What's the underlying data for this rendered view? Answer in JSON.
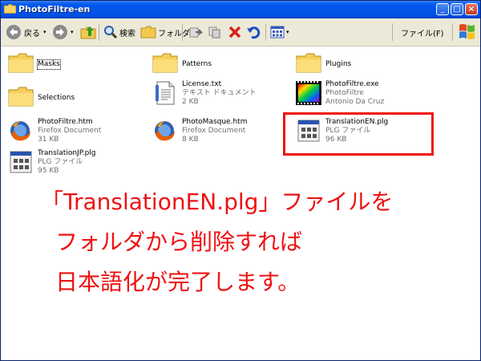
{
  "window": {
    "title": "PhotoFiltre-en"
  },
  "toolbar": {
    "back_label": "戻る",
    "search_label": "検索",
    "folders_label": "フォルダ",
    "file_menu_label": "ファイル(F)"
  },
  "items": [
    {
      "name": "Masks",
      "type": "folder"
    },
    {
      "name": "Patterns",
      "type": "folder"
    },
    {
      "name": "Plugins",
      "type": "folder"
    },
    {
      "name": "Selections",
      "type": "folder"
    },
    {
      "name": "License.txt",
      "line1": "テキスト ドキュメント",
      "line2": "2 KB",
      "type": "text"
    },
    {
      "name": "PhotoFiltre.exe",
      "line1": "PhotoFiltre",
      "line2": "Antonio Da Cruz",
      "type": "exe"
    },
    {
      "name": "PhotoFiltre.htm",
      "line1": "Firefox Document",
      "line2": "31 KB",
      "type": "html"
    },
    {
      "name": "PhotoMasque.htm",
      "line1": "Firefox Document",
      "line2": "8 KB",
      "type": "html"
    },
    {
      "name": "TranslationEN.plg",
      "line1": "PLG ファイル",
      "line2": "96 KB",
      "type": "plg"
    },
    {
      "name": "TranslationJP.plg",
      "line1": "PLG ファイル",
      "line2": "95 KB",
      "type": "plg"
    }
  ],
  "annotation": {
    "line1": "「TranslationEN.plg」ファイルを",
    "line2": "フォルダから削除すれば",
    "line3": "日本語化が完了します。"
  },
  "colors": {
    "title_bar": "#0058ee",
    "annotation_red": "#ee1111"
  }
}
